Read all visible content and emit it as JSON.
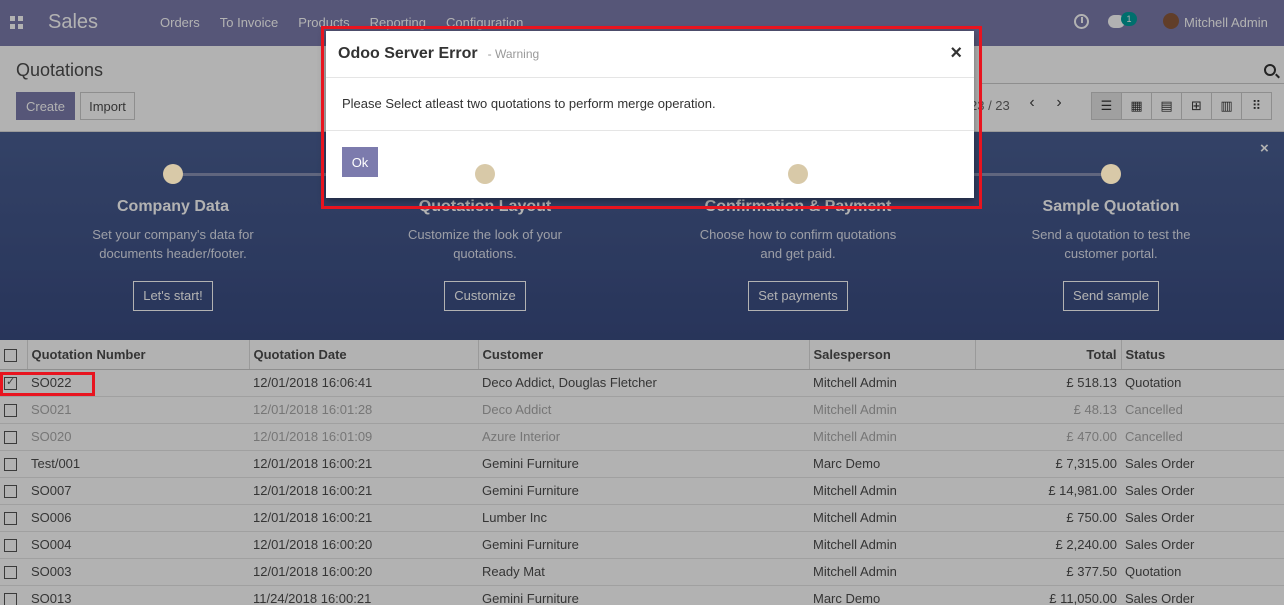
{
  "navbar": {
    "brand": "Sales",
    "menu": [
      "Orders",
      "To Invoice",
      "Products",
      "Reporting",
      "Configuration"
    ],
    "chat_badge": "1",
    "user_name": "Mitchell Admin"
  },
  "control": {
    "title": "Quotations",
    "create_label": "Create",
    "import_label": "Import",
    "pager": "23 / 23"
  },
  "banner": {
    "close": "×",
    "steps": [
      {
        "title": "Company Data",
        "desc": "Set your company's data for documents header/footer.",
        "button": "Let's start!"
      },
      {
        "title": "Quotation Layout",
        "desc": "Customize the look of your quotations.",
        "button": "Customize"
      },
      {
        "title": "Confirmation & Payment",
        "desc": "Choose how to confirm quotations and get paid.",
        "button": "Set payments"
      },
      {
        "title": "Sample Quotation",
        "desc": "Send a quotation to test the customer portal.",
        "button": "Send sample"
      }
    ]
  },
  "table": {
    "columns": [
      "Quotation Number",
      "Quotation Date",
      "Customer",
      "Salesperson",
      "Total",
      "Status"
    ],
    "rows": [
      {
        "number": "SO022",
        "date": "12/01/2018 16:06:41",
        "customer": "Deco Addict, Douglas Fletcher",
        "salesperson": "Mitchell Admin",
        "total": "£ 518.13",
        "status": "Quotation",
        "checked": true,
        "muted": false
      },
      {
        "number": "SO021",
        "date": "12/01/2018 16:01:28",
        "customer": "Deco Addict",
        "salesperson": "Mitchell Admin",
        "total": "£ 48.13",
        "status": "Cancelled",
        "checked": false,
        "muted": true
      },
      {
        "number": "SO020",
        "date": "12/01/2018 16:01:09",
        "customer": "Azure Interior",
        "salesperson": "Mitchell Admin",
        "total": "£ 470.00",
        "status": "Cancelled",
        "checked": false,
        "muted": true
      },
      {
        "number": "Test/001",
        "date": "12/01/2018 16:00:21",
        "customer": "Gemini Furniture",
        "salesperson": "Marc Demo",
        "total": "£ 7,315.00",
        "status": "Sales Order",
        "checked": false,
        "muted": false
      },
      {
        "number": "SO007",
        "date": "12/01/2018 16:00:21",
        "customer": "Gemini Furniture",
        "salesperson": "Mitchell Admin",
        "total": "£ 14,981.00",
        "status": "Sales Order",
        "checked": false,
        "muted": false
      },
      {
        "number": "SO006",
        "date": "12/01/2018 16:00:21",
        "customer": "Lumber Inc",
        "salesperson": "Mitchell Admin",
        "total": "£ 750.00",
        "status": "Sales Order",
        "checked": false,
        "muted": false
      },
      {
        "number": "SO004",
        "date": "12/01/2018 16:00:20",
        "customer": "Gemini Furniture",
        "salesperson": "Mitchell Admin",
        "total": "£ 2,240.00",
        "status": "Sales Order",
        "checked": false,
        "muted": false
      },
      {
        "number": "SO003",
        "date": "12/01/2018 16:00:20",
        "customer": "Ready Mat",
        "salesperson": "Mitchell Admin",
        "total": "£ 377.50",
        "status": "Quotation",
        "checked": false,
        "muted": false
      },
      {
        "number": "SO013",
        "date": "11/24/2018 16:00:21",
        "customer": "Gemini Furniture",
        "salesperson": "Marc Demo",
        "total": "£ 11,050.00",
        "status": "Sales Order",
        "checked": false,
        "muted": false
      }
    ]
  },
  "modal": {
    "title": "Odoo Server Error",
    "subtitle": "- Warning",
    "close": "×",
    "message": "Please Select atleast two quotations to perform merge operation.",
    "ok_label": "Ok"
  },
  "colors": {
    "primary": "#7c7bad",
    "highlight": "#e8141f",
    "banner": "#3a4c82"
  }
}
